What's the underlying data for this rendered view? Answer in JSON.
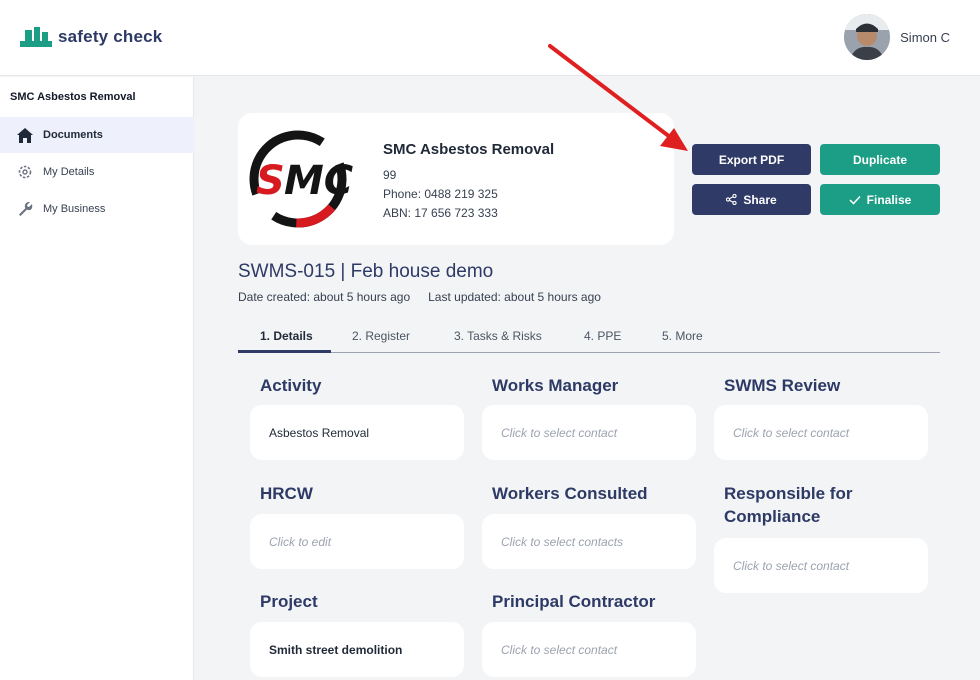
{
  "app": {
    "name": "safety check"
  },
  "user": {
    "name": "Simon C"
  },
  "sidebar": {
    "org": "SMC Asbestos Removal",
    "items": [
      {
        "label": "Documents",
        "icon": "home-icon"
      },
      {
        "label": "My Details",
        "icon": "gear-icon"
      },
      {
        "label": "My Business",
        "icon": "wrench-icon"
      }
    ]
  },
  "company": {
    "logo_text": "SMC",
    "name": "SMC Asbestos Removal",
    "address": "99",
    "phone": "Phone: 0488 219 325",
    "abn": "ABN: 17 656 723 333"
  },
  "actions": {
    "export_pdf": "Export PDF",
    "duplicate": "Duplicate",
    "share": "Share",
    "finalise": "Finalise"
  },
  "document": {
    "title": "SWMS-015 | Feb house demo",
    "created": "Date created: about 5 hours ago",
    "updated": "Last updated: about 5 hours ago"
  },
  "tabs": [
    "1. Details",
    "2. Register",
    "3. Tasks & Risks",
    "4. PPE",
    "5. More"
  ],
  "fields": {
    "activity": {
      "label": "Activity",
      "value": "Asbestos Removal"
    },
    "works_manager": {
      "label": "Works Manager",
      "value": "Click to select contact"
    },
    "swms_review": {
      "label": "SWMS Review",
      "value": "Click to select contact"
    },
    "hrcw": {
      "label": "HRCW",
      "value": "Click to edit"
    },
    "workers_consulted": {
      "label": "Workers Consulted",
      "value": "Click to select contacts"
    },
    "responsible_1": "Responsible for",
    "responsible_2": "Compliance",
    "responsible_value": "Click to select contact",
    "project": {
      "label": "Project",
      "value": "Smith street demolition"
    },
    "principal_contractor": {
      "label": "Principal Contractor",
      "value": "Click to select contact"
    }
  },
  "colors": {
    "navy": "#2f3a67",
    "teal": "#1c9d85",
    "arrow": "#e02020",
    "logo_red": "#d71920"
  }
}
